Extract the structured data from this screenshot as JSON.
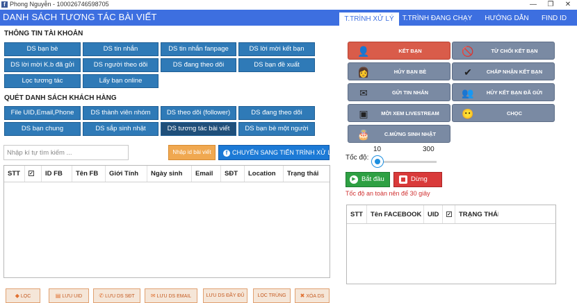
{
  "window": {
    "title": "Phong Nguyễn - 100026746598705",
    "minimize": "—",
    "restore": "❐",
    "close": "✕"
  },
  "header": {
    "app_title": "DANH SÁCH TƯƠNG TÁC BÀI VIẾT",
    "tabs": [
      "T.TRÌNH XỬ LÝ",
      "T.TRÌNH ĐANG CHẠY",
      "HƯỚNG DẪN",
      "FIND ID"
    ]
  },
  "account_info": {
    "heading": "THÔNG TIN TÀI KHOẢN",
    "buttons": [
      "DS bạn bè",
      "DS tin nhắn",
      "DS tin nhắn fanpage",
      "DS lời mời kết bạn",
      "DS lời mời K.b đã gửi",
      "DS người theo dõi",
      "DS đang theo dõi",
      "DS bạn đề xuất",
      "Lọc tương tác",
      "Lấy bạn online"
    ]
  },
  "scan_customers": {
    "heading": "QUÉT DANH SÁCH KHÁCH HÀNG",
    "buttons": [
      "File UID,Email,Phone",
      "DS thành viên nhóm",
      "DS theo dõi (follower)",
      "DS đang theo dõi",
      "DS bạn chung",
      "DS sắp sinh nhật",
      "DS tương tác bài viết",
      "DS bạn bè một người"
    ]
  },
  "search": {
    "placeholder": "Nhập kí tự tìm kiếm ...",
    "import_button": "Nhập id bài viết",
    "switch_button": "CHUYỂN SANG TIẾN TRÌNH XỬ LÝ"
  },
  "main_table": {
    "columns": [
      "STT",
      "✓",
      "ID FB",
      "Tên FB",
      "Giới Tính",
      "Ngày sinh",
      "Email",
      "SĐT",
      "Location",
      "Trạng thái"
    ]
  },
  "bottom_buttons": [
    "LỌC",
    "LƯU UID",
    "LƯU DS SĐT",
    "LƯU DS EMAIL",
    "LƯU DS ĐẦY ĐỦ",
    "LỌC TRÙNG",
    "XÓA DS"
  ],
  "actions": [
    {
      "label": "KẾT BẠN",
      "icon": "👤"
    },
    {
      "label": "TỪ CHỐI KẾT BẠN",
      "icon": "🚫"
    },
    {
      "label": "HỦY BẠN BÈ",
      "icon": "👩"
    },
    {
      "label": "CHẤP NHẬN KẾT BẠN",
      "icon": "✔"
    },
    {
      "label": "GỬI TIN NHẮN",
      "icon": "✉"
    },
    {
      "label": "HỦY KẾT BẠN ĐÃ GỬI",
      "icon": "👥"
    },
    {
      "label": "MỜI XEM LIVESTREAM",
      "icon": "▣"
    },
    {
      "label": "CHỌC",
      "icon": "😶"
    },
    {
      "label": "C.MỪNG SINH NHẬT",
      "icon": "🎂"
    }
  ],
  "speed": {
    "label": "Tốc độ:",
    "min": "10",
    "max": "300",
    "value_fraction": 0.0
  },
  "controls": {
    "start": "Bắt đầu",
    "stop": "Dừng",
    "note": "Tốc độ an toàn nên để 30 giây"
  },
  "status_table": {
    "columns": [
      "STT",
      "Tên FACEBOOK",
      "UID",
      "✓",
      "TRẠNG THÁI"
    ]
  }
}
